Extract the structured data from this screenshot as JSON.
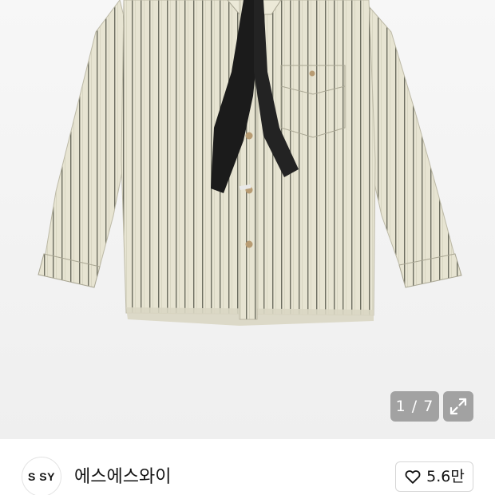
{
  "gallery": {
    "image_alt": "striped shirt with black tie",
    "counter": "1 / 7",
    "expand_icon": "expand-arrows-icon"
  },
  "seller": {
    "avatar_text": "S SY",
    "name": "에스에스와이"
  },
  "like": {
    "icon": "heart-outline-icon",
    "count": "5.6만"
  },
  "colors": {
    "shirt": "#e6e3d1",
    "stripe": "#6f7063",
    "tie": "#1b1b1b",
    "background": "#f4f4f4"
  }
}
